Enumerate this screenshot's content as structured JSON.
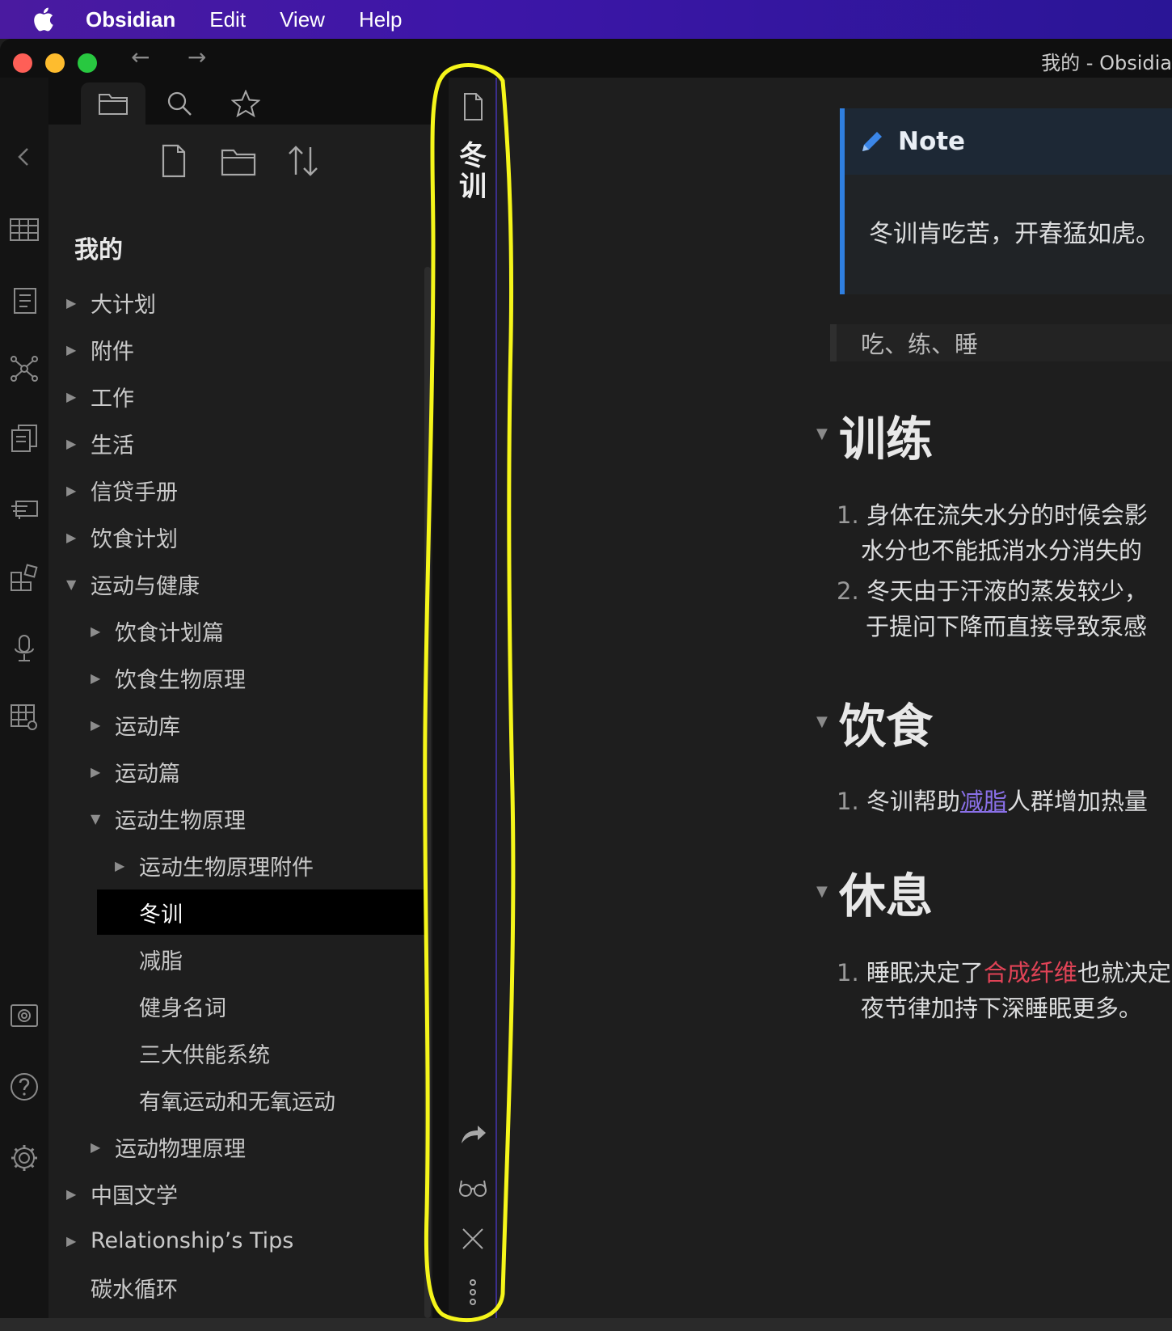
{
  "menubar": {
    "app": "Obsidian",
    "items": [
      "Edit",
      "View",
      "Help"
    ]
  },
  "window": {
    "title": "我的 - Obsidia",
    "back": "←",
    "forward": "→"
  },
  "sidebar": {
    "vault_name": "我的",
    "tree": [
      {
        "label": "大计划",
        "arrow": "▶"
      },
      {
        "label": "附件",
        "arrow": "▶"
      },
      {
        "label": "工作",
        "arrow": "▶"
      },
      {
        "label": "生活",
        "arrow": "▶"
      },
      {
        "label": "信贷手册",
        "arrow": "▶"
      },
      {
        "label": "饮食计划",
        "arrow": "▶"
      },
      {
        "label": "运动与健康",
        "arrow": "▼"
      },
      {
        "label": "饮食计划篇",
        "arrow": "▶"
      },
      {
        "label": "饮食生物原理",
        "arrow": "▶"
      },
      {
        "label": "运动库",
        "arrow": "▶"
      },
      {
        "label": "运动篇",
        "arrow": "▶"
      },
      {
        "label": "运动生物原理",
        "arrow": "▼"
      },
      {
        "label": "运动生物原理附件",
        "arrow": "▶"
      },
      {
        "label": "冬训",
        "arrow": ""
      },
      {
        "label": "减脂",
        "arrow": ""
      },
      {
        "label": "健身名词",
        "arrow": ""
      },
      {
        "label": "三大供能系统",
        "arrow": ""
      },
      {
        "label": "有氧运动和无氧运动",
        "arrow": ""
      },
      {
        "label": "运动物理原理",
        "arrow": "▶"
      },
      {
        "label": "中国文学",
        "arrow": "▶"
      },
      {
        "label": "Relationship’s Tips",
        "arrow": "▶"
      },
      {
        "label": "碳水循环",
        "arrow": ""
      }
    ]
  },
  "stacked_tab": {
    "title": "冬训"
  },
  "note": {
    "callout": {
      "title": "Note",
      "body": "冬训肯吃苦，开春猛如虎。"
    },
    "quote": "吃、练、睡",
    "sections": [
      {
        "heading": "训练",
        "items": [
          {
            "num": "1.",
            "lines": [
              "身体在流失水分的时候会影",
              "水分也不能抵消水分消失的"
            ]
          },
          {
            "num": "2.",
            "lines": [
              "冬天由于汗液的蒸发较少，",
              "于提问下降而直接导致泵感"
            ]
          }
        ]
      },
      {
        "heading": "饮食",
        "items": [
          {
            "num": "1.",
            "before": "冬训帮助",
            "link": "减脂",
            "after": "人群增加热量"
          }
        ]
      },
      {
        "heading": "休息",
        "items": [
          {
            "num": "1.",
            "before": "睡眠决定了",
            "link": "合成纤维",
            "after": "也就决定",
            "line2": "夜节律加持下深睡眠更多。"
          }
        ]
      }
    ]
  },
  "colors": {
    "accent_purple": "#8a70e8",
    "callout_blue": "#2f7fe0",
    "link_red": "#e04356",
    "annotation_yellow": "#f5f51a"
  }
}
